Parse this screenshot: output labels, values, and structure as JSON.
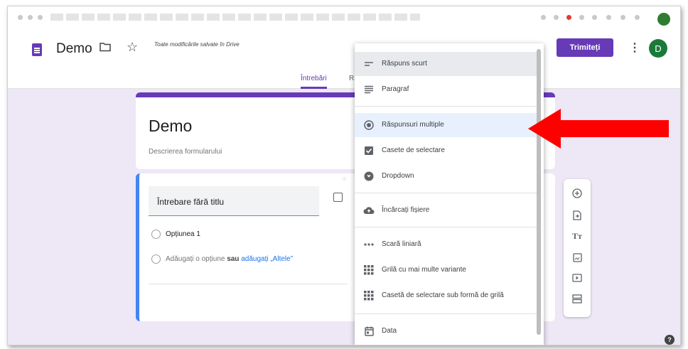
{
  "header": {
    "doc_title": "Demo",
    "saved_status": "Toate modificările salvate în Drive",
    "send_label": "Trimiteți",
    "avatar_initial": "D",
    "folder_icon": "folder-icon",
    "star_icon": "star-icon",
    "more_icon": "more-vert-icon",
    "brand_color": "#673ab7"
  },
  "tabs": [
    {
      "label": "Întrebări",
      "active": true
    },
    {
      "label": "Ră"
    }
  ],
  "form": {
    "title": "Demo",
    "description": "Descrierea formularului"
  },
  "question": {
    "title": "Întrebare fără titlu",
    "option_1": "Opțiunea 1",
    "add_option": "Adăugați o opțiune",
    "or_label": "sau",
    "add_other": "adăugați „Altele”"
  },
  "menu": {
    "items": [
      {
        "label": "Răspuns scurt",
        "icon": "short-text-icon"
      },
      {
        "label": "Paragraf",
        "icon": "paragraph-icon"
      },
      {
        "label": "Răspunsuri multiple",
        "icon": "radio-button-icon"
      },
      {
        "label": "Casete de selectare",
        "icon": "checkbox-icon"
      },
      {
        "label": "Dropdown",
        "icon": "dropdown-icon"
      },
      {
        "label": "Încărcați fișiere",
        "icon": "cloud-upload-icon"
      },
      {
        "label": "Scară liniară",
        "icon": "linear-scale-icon"
      },
      {
        "label": "Grilă cu mai multe variante",
        "icon": "grid-icon"
      },
      {
        "label": "Casetă de selectare sub formă de grilă",
        "icon": "checkbox-grid-icon"
      },
      {
        "label": "Data",
        "icon": "calendar-icon"
      }
    ]
  },
  "toolbar": {
    "icons": [
      "add-question-icon",
      "import-questions-icon",
      "add-title-icon",
      "add-image-icon",
      "add-video-icon",
      "add-section-icon"
    ]
  },
  "annotation": {
    "arrow_color": "#ff0000"
  }
}
